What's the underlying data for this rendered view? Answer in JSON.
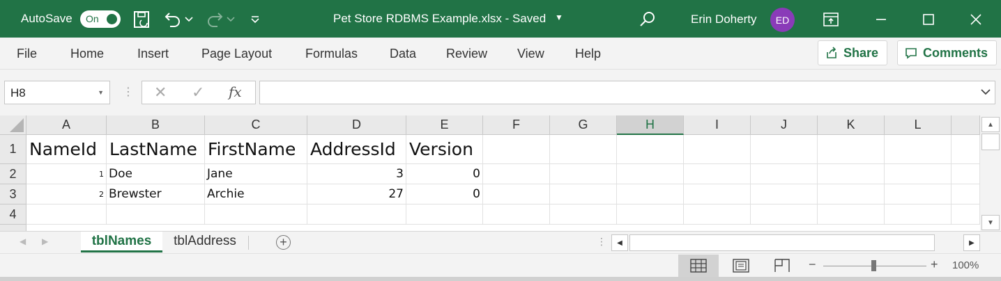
{
  "titlebar": {
    "autosave_label": "AutoSave",
    "autosave_state": "On",
    "document_title": "Pet Store RDBMS Example.xlsx  -  Saved",
    "user_name": "Erin Doherty",
    "user_initials": "ED",
    "accent_color": "#217346",
    "avatar_color": "#8a3bb8",
    "icons": [
      "save-icon",
      "undo-icon",
      "redo-icon",
      "customize-toolbar-icon",
      "search-icon",
      "ribbon-display-icon",
      "minimize-icon",
      "maximize-icon",
      "close-icon"
    ]
  },
  "menu": {
    "items": [
      "File",
      "Home",
      "Insert",
      "Page Layout",
      "Formulas",
      "Data",
      "Review",
      "View",
      "Help"
    ],
    "share_label": "Share",
    "comments_label": "Comments"
  },
  "formula_bar": {
    "name_box": "H8",
    "fx_label": "fx",
    "formula": ""
  },
  "sheet": {
    "columns": [
      "A",
      "B",
      "C",
      "D",
      "E",
      "F",
      "G",
      "H",
      "I",
      "J",
      "K",
      "L"
    ],
    "selected_column": "H",
    "rows": [
      "1",
      "2",
      "3",
      "4"
    ],
    "header_row": [
      "NameId",
      "LastName",
      "FirstName",
      "AddressId",
      "Version"
    ],
    "data_rows": [
      {
        "NameId": "1",
        "LastName": "Doe",
        "FirstName": "Jane",
        "AddressId": "3",
        "Version": "0"
      },
      {
        "NameId": "2",
        "LastName": "Brewster",
        "FirstName": "Archie",
        "AddressId": "27",
        "Version": "0"
      }
    ]
  },
  "tabs": {
    "active": "tblNames",
    "inactive": "tblAddress"
  },
  "status": {
    "zoom": "100%",
    "zoom_minus": "−",
    "zoom_plus": "+"
  }
}
